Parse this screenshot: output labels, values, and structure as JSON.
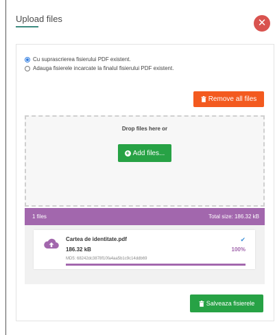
{
  "dialog": {
    "title": "Upload files",
    "close_icon": "close-icon",
    "close_glyph": "✕",
    "accent_color": "#3b8a7e"
  },
  "options": {
    "items": [
      {
        "label": "Cu suprascrierea fisierului PDF existent.",
        "checked": true
      },
      {
        "label": "Adauga fisierele incarcate la finalul fisierului PDF existent.",
        "checked": false
      }
    ]
  },
  "actions": {
    "remove_all_label": "Remove all files",
    "remove_icon": "trash-icon",
    "add_files_label": "Add files...",
    "add_icon": "plus-circle-icon",
    "save_label": "Salveaza fisierele",
    "save_icon": "trash-icon",
    "remove_color": "#f35a1f",
    "add_color": "#27a245"
  },
  "dropzone": {
    "text": "Drop files here or"
  },
  "file_summary": {
    "count": "1 files",
    "total": "Total size: 186.32 kB",
    "bar_color": "#a267ad"
  },
  "files": [
    {
      "name": "Cartea de identitate.pdf",
      "size": "186.32 kB",
      "md5": "MD5: 68242dc3878f10fa4aa5b1c9c14ddb69",
      "status_icon": "check-icon",
      "percent": "100%",
      "progress": 1.0,
      "icon": "cloud-upload-icon"
    }
  ]
}
